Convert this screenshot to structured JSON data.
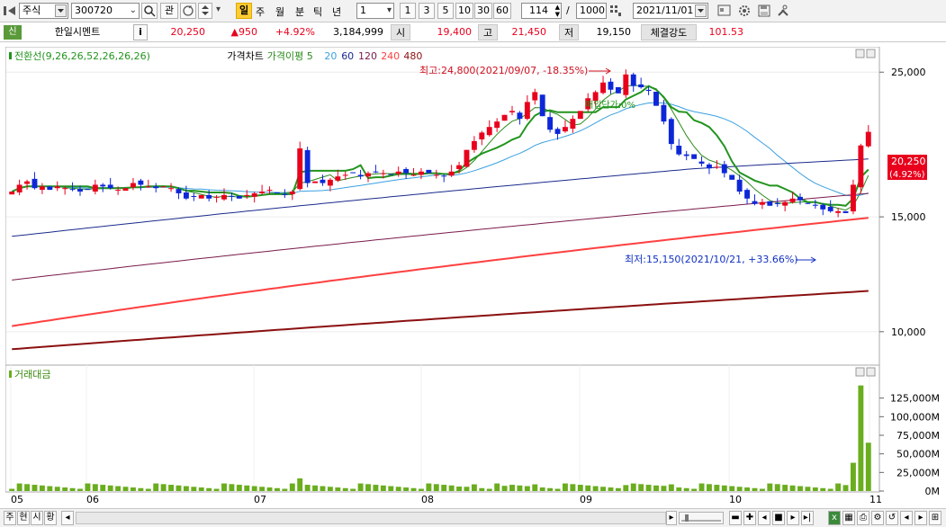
{
  "toolbar": {
    "market": "주식",
    "code": "300720",
    "btn_gwan": "관",
    "periods": [
      "일",
      "주",
      "월",
      "분",
      "틱",
      "년"
    ],
    "unit_value": "1",
    "quick_units": [
      "1",
      "3",
      "5",
      "10",
      "30",
      "60"
    ],
    "count": "114",
    "slash": "/",
    "total": "1000",
    "date": "2021/11/01"
  },
  "quote": {
    "sin_badge": "신",
    "name": "한일시멘트",
    "info": "i",
    "price": "20,250",
    "change": "▲950",
    "change_pct": "+4.92%",
    "volume": "3,184,999",
    "open_label": "시",
    "open": "19,400",
    "high_label": "고",
    "high": "21,450",
    "low_label": "저",
    "low": "19,150",
    "strength_label": "체결강도",
    "strength": "101.53"
  },
  "colors": {
    "up": "#e8001c",
    "down": "#0d27d8",
    "ichimoku": "#22941e",
    "ma5": "#2a8a1a",
    "ma20": "#3aa0e0",
    "ma60": "#1a2a8c",
    "ma120": "#7a1a4a",
    "ma240": "#ff4040",
    "ma480": "#8b1010",
    "volume": "#6aad1e"
  },
  "legend_price": {
    "items": [
      {
        "text": "전환선(9,26,26,52,26,26,26)",
        "color": "#22941e"
      },
      {
        "text": "가격차트",
        "color": "#000000"
      },
      {
        "text": "가격이평 5",
        "color": "#2a8a1a"
      },
      {
        "text": "20",
        "color": "#3aa0e0"
      },
      {
        "text": "60",
        "color": "#1a2a8c"
      },
      {
        "text": "120",
        "color": "#7a1a4a"
      },
      {
        "text": "240",
        "color": "#ff4040"
      },
      {
        "text": "480",
        "color": "#8b1010"
      }
    ]
  },
  "legend_volume": {
    "text": "거래대금"
  },
  "chart_data": [
    {
      "type": "candlestick",
      "y_ticks": [
        "25,000",
        "15,000",
        "10,000"
      ],
      "y_tick_values": [
        25000,
        15000,
        10000
      ],
      "ylim": [
        9000,
        27000
      ],
      "x_month_labels": [
        "05",
        "06",
        "07",
        "08",
        "09",
        "10",
        "11"
      ],
      "annotation_high": "최고:24,800(2021/09/07, -18.35%)",
      "annotation_low": "최저:15,150(2021/10/21, +33.66%)",
      "annotation_pct": "매입단가:0%",
      "last_price": "20,250",
      "last_pct": "(4.92%)"
    },
    {
      "type": "bar",
      "title": "거래대금",
      "y_ticks": [
        "125,000M",
        "100,000M",
        "75,000M",
        "50,000M",
        "25,000M",
        "0M"
      ],
      "y_tick_values": [
        125000,
        100000,
        75000,
        50000,
        25000,
        0
      ],
      "ylim": [
        0,
        150000
      ]
    }
  ],
  "bottombar": {
    "tabs": [
      "주",
      "현",
      "시",
      "황"
    ]
  }
}
